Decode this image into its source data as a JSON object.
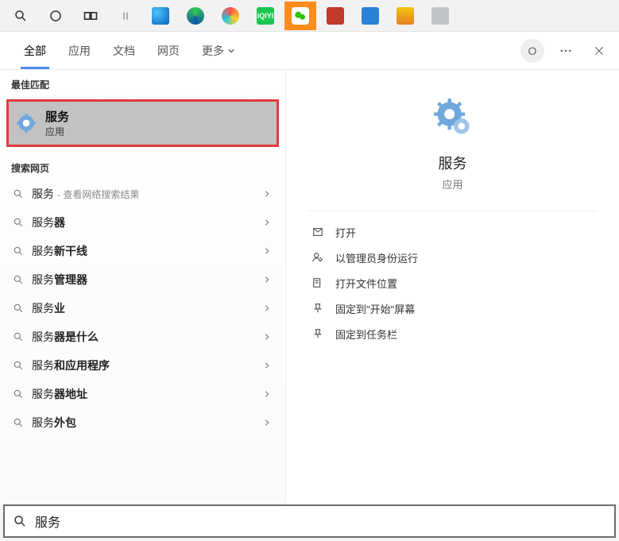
{
  "taskbar": {
    "items": [
      {
        "name": "search-icon"
      },
      {
        "name": "cortana-icon"
      },
      {
        "name": "task-view-icon"
      },
      {
        "name": "divider-icon"
      },
      {
        "name": "edge-legacy-icon"
      },
      {
        "name": "edge-icon"
      },
      {
        "name": "browser-colorful-icon"
      },
      {
        "name": "iqiyi-icon",
        "active": false
      },
      {
        "name": "wechat-icon",
        "active": true
      },
      {
        "name": "toolbox-icon"
      },
      {
        "name": "screen-app-icon"
      },
      {
        "name": "settings-tool-icon"
      },
      {
        "name": "computer-icon"
      }
    ]
  },
  "tabs": {
    "items": [
      {
        "label": "全部",
        "active": true
      },
      {
        "label": "应用"
      },
      {
        "label": "文档"
      },
      {
        "label": "网页"
      },
      {
        "label": "更多",
        "has_chevron": true
      }
    ],
    "avatar_letter": "O"
  },
  "left": {
    "best_match_label": "最佳匹配",
    "best_match": {
      "title": "服务",
      "subtitle": "应用"
    },
    "web_label": "搜索网页",
    "web_items": [
      {
        "prefix": "服务",
        "bold": "",
        "suffix": " - 查看网络搜索结果"
      },
      {
        "prefix": "服务",
        "bold": "器",
        "suffix": ""
      },
      {
        "prefix": "服务",
        "bold": "新干线",
        "suffix": ""
      },
      {
        "prefix": "服务",
        "bold": "管理器",
        "suffix": ""
      },
      {
        "prefix": "服务",
        "bold": "业",
        "suffix": ""
      },
      {
        "prefix": "服务",
        "bold": "器是什么",
        "suffix": ""
      },
      {
        "prefix": "服务",
        "bold": "和应用程序",
        "suffix": ""
      },
      {
        "prefix": "服务",
        "bold": "器地址",
        "suffix": ""
      },
      {
        "prefix": "服务",
        "bold": "外包",
        "suffix": ""
      }
    ]
  },
  "right": {
    "title": "服务",
    "subtitle": "应用",
    "actions": [
      {
        "icon": "open-icon",
        "label": "打开"
      },
      {
        "icon": "admin-run-icon",
        "label": "以管理员身份运行"
      },
      {
        "icon": "open-location-icon",
        "label": "打开文件位置"
      },
      {
        "icon": "pin-start-icon",
        "label": "固定到\"开始\"屏幕"
      },
      {
        "icon": "pin-taskbar-icon",
        "label": "固定到任务栏"
      }
    ]
  },
  "search": {
    "value": "服务"
  }
}
